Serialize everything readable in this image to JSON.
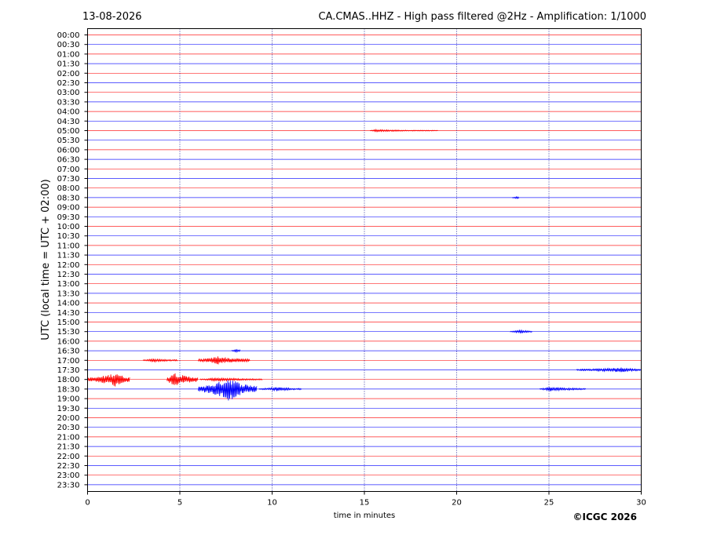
{
  "header": {
    "date": "13-08-2026",
    "station_title": "CA.CMAS..HHZ - High pass filtered @2Hz - Amplification: 1/1000"
  },
  "copyright": "©ICGC 2026",
  "colors": {
    "trace_a": "#ff0000",
    "trace_b": "#0000ff",
    "grid": "#00008b",
    "frame": "#000000"
  },
  "chart_data": {
    "type": "line",
    "subtype": "helicorder",
    "xlabel": "time in minutes",
    "ylabel": "UTC (local time = UTC + 02:00)",
    "xlim": [
      0,
      30
    ],
    "x_ticks": [
      0,
      5,
      10,
      15,
      20,
      25,
      30
    ],
    "x_gridlines": [
      5,
      10,
      15,
      20,
      25
    ],
    "grid": "vertical dotted",
    "trace_color_cycle": [
      "#ff0000",
      "#0000ff"
    ],
    "rows": [
      "00:00",
      "00:30",
      "01:00",
      "01:30",
      "02:00",
      "02:30",
      "03:00",
      "03:30",
      "04:00",
      "04:30",
      "05:00",
      "05:30",
      "06:00",
      "06:30",
      "07:00",
      "07:30",
      "08:00",
      "08:30",
      "09:00",
      "09:30",
      "10:00",
      "10:30",
      "11:00",
      "11:30",
      "12:00",
      "12:30",
      "13:00",
      "13:30",
      "14:00",
      "14:30",
      "15:00",
      "15:30",
      "16:00",
      "16:30",
      "17:00",
      "17:30",
      "18:00",
      "18:30",
      "19:00",
      "19:30",
      "20:00",
      "20:30",
      "21:00",
      "21:30",
      "22:00",
      "22:30",
      "23:00",
      "23:30"
    ],
    "events": [
      {
        "row": "05:00",
        "start_min": 15.3,
        "end_min": 19.0,
        "peak_min": 15.6,
        "amplitude": 1.5
      },
      {
        "row": "08:30",
        "start_min": 23.0,
        "end_min": 23.4,
        "peak_min": 23.2,
        "amplitude": 1.5
      },
      {
        "row": "15:30",
        "start_min": 22.9,
        "end_min": 24.1,
        "peak_min": 23.5,
        "amplitude": 2.5
      },
      {
        "row": "16:30",
        "start_min": 7.8,
        "end_min": 8.3,
        "peak_min": 8.0,
        "amplitude": 2.5
      },
      {
        "row": "17:00",
        "start_min": 3.0,
        "end_min": 4.9,
        "peak_min": 3.6,
        "amplitude": 2.5
      },
      {
        "row": "17:00",
        "start_min": 6.0,
        "end_min": 8.8,
        "peak_min": 7.1,
        "amplitude": 6
      },
      {
        "row": "17:30",
        "start_min": 26.5,
        "end_min": 30.0,
        "peak_min": 29.0,
        "amplitude": 3.5
      },
      {
        "row": "18:00",
        "start_min": 0.0,
        "end_min": 2.3,
        "peak_min": 1.6,
        "amplitude": 10
      },
      {
        "row": "18:00",
        "start_min": 4.3,
        "end_min": 6.0,
        "peak_min": 4.6,
        "amplitude": 11
      },
      {
        "row": "18:00",
        "start_min": 6.1,
        "end_min": 9.5,
        "peak_min": 7.0,
        "amplitude": 2.5
      },
      {
        "row": "18:30",
        "start_min": 6.0,
        "end_min": 9.2,
        "peak_min": 7.7,
        "amplitude": 16
      },
      {
        "row": "18:30",
        "start_min": 9.3,
        "end_min": 11.6,
        "peak_min": 10.3,
        "amplitude": 3
      },
      {
        "row": "18:30",
        "start_min": 24.5,
        "end_min": 27.0,
        "peak_min": 25.0,
        "amplitude": 3
      }
    ]
  }
}
